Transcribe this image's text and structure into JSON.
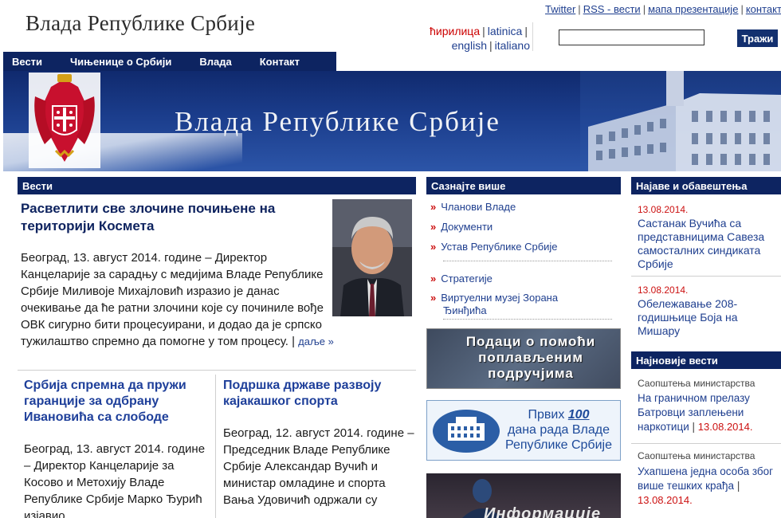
{
  "header": {
    "site_title": "Влада Републике Србије",
    "top_links": [
      "Twitter",
      "RSS - вести",
      "мапа презентације",
      "контакт"
    ],
    "languages": {
      "active": "ћирилица",
      "latin": "latinica",
      "english": "english",
      "italian": "italiano"
    },
    "search": {
      "value": "",
      "button": "Тражи"
    }
  },
  "nav": {
    "items": [
      "Вести",
      "Чињенице о Србији",
      "Влада",
      "Контакт"
    ]
  },
  "banner": {
    "title": "Влада Републике Србије"
  },
  "news": {
    "header": "Вести",
    "lead": {
      "title": "Расветлити све злочине почињене на територији Космета",
      "body": "Београд, 13. август 2014. године – Директор Канцеларије за сарадњу с медијима Владе Републике Србије Миливоје Михајловић изразио је данас очекивање да ће ратни злочини које су починиле вође ОВК сигурно бити процесуирани, и додао да је српско тужилаштво спремно да помогне у том процесу. |",
      "more": "даље »"
    },
    "item2": {
      "title": "Србија спремна да пружи гаранције за одбрану Ивановића са слободе",
      "body": "Београд, 13. август 2014. године – Директор Канцеларије за Косово и Метохију Владе Републике Србије Марко Ђурић изјавио"
    },
    "item3": {
      "title": "Подршка државе развоју кајакашког спорта",
      "body": "Београд, 12. август 2014. године – Председник Владе Републике Србије Александар Вучић и министар омладине и спорта Вања Удовичић одржали су"
    }
  },
  "learn_more": {
    "header": "Сазнајте више",
    "links": [
      "Чланови Владе",
      "Документи",
      "Устав Републике Србије"
    ],
    "links2": [
      "Стратегије",
      "Виртуелни музеј Зорана Ђинђића"
    ],
    "flood_banner": "Подаци о помоћи поплављеним подручјима",
    "days_banner": {
      "prefix": "Првих ",
      "number": "100",
      "suffix": "дана рада Владе Републике Србије"
    },
    "info_banner": "Информације"
  },
  "announcements": {
    "header": "Најаве и обавештења",
    "items": [
      {
        "date": "13.08.2014.",
        "text": "Састанак Вучића са представницима Савеза самосталних синдиката Србије"
      },
      {
        "date": "13.08.2014.",
        "text": "Обележавање 208-годишњице Боја на Мишару"
      }
    ]
  },
  "latest": {
    "header": "Најновије вести",
    "items": [
      {
        "category": "Саопштења министарства",
        "text": "На граничном прелазу Батровци заплењени наркотици",
        "date": "13.08.2014."
      },
      {
        "category": "Саопштења министарства",
        "text": "Ухапшена једна особа због више тешких крађа",
        "date": "13.08.2014."
      }
    ]
  },
  "colors": {
    "navy": "#0d2461",
    "link": "#1f3f8f",
    "date_red": "#cc1111"
  }
}
